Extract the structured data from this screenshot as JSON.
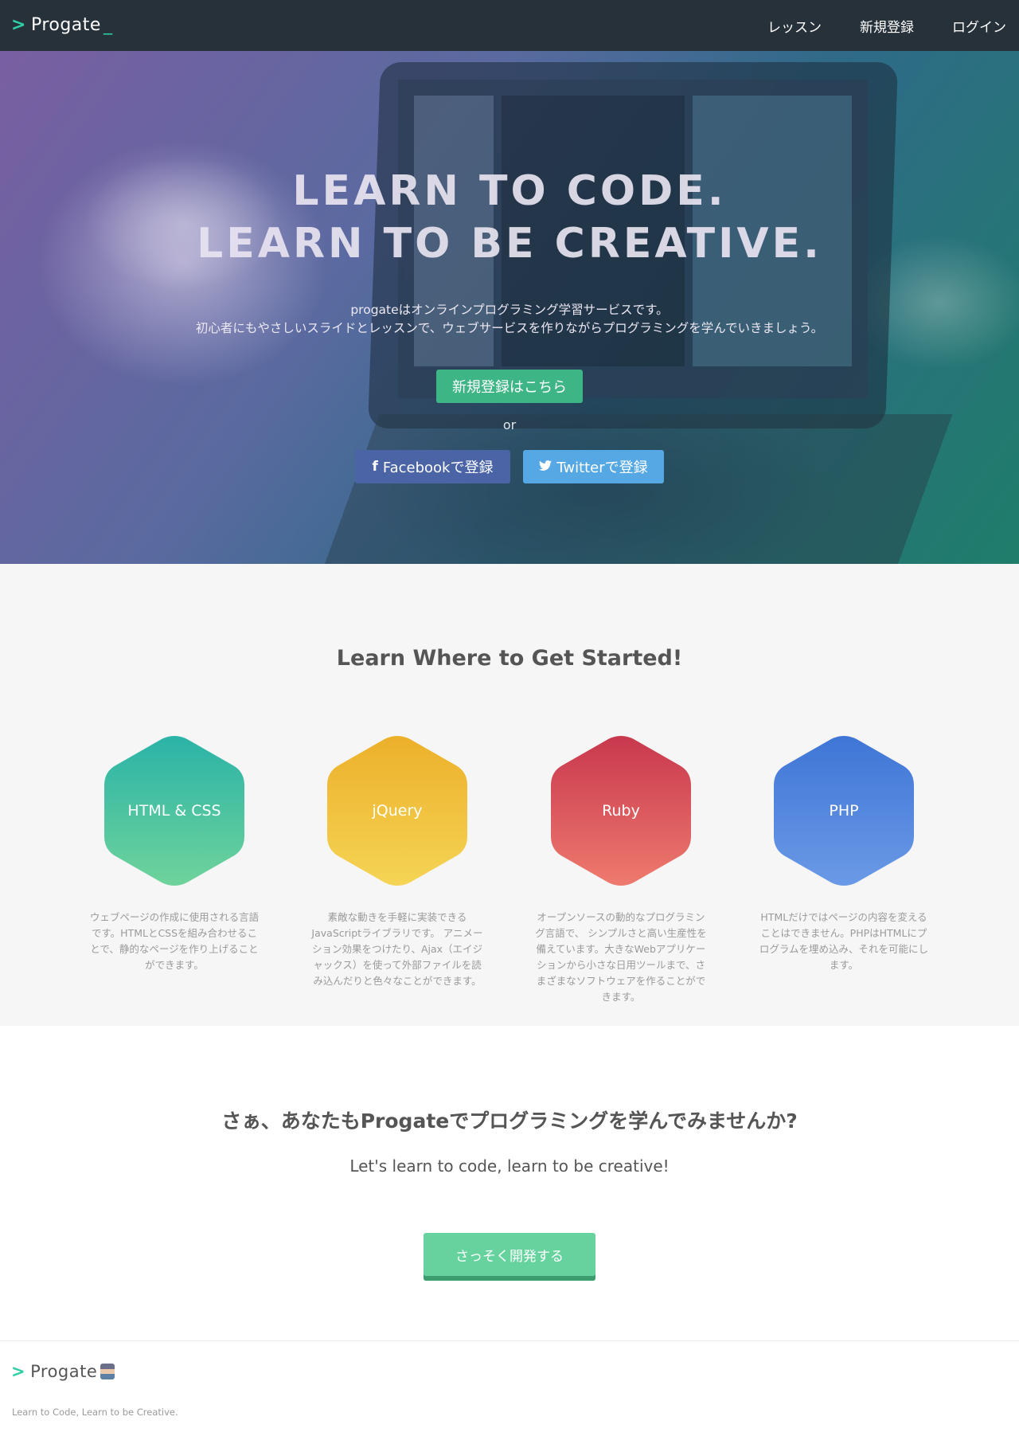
{
  "header": {
    "logo_text": "Progate",
    "nav": [
      "レッスン",
      "新規登録",
      "ログイン"
    ]
  },
  "hero": {
    "title_line1": "LEARN TO CODE.",
    "title_line2": "LEARN TO BE CREATIVE.",
    "subtitle_line1": "progateはオンラインプログラミング学習サービスです。",
    "subtitle_line2": "初心者にもやさしいスライドとレッスンで、ウェブサービスを作りながらプログラミングを学んでいきましょう。",
    "signup_button": "新規登録はこちら",
    "or_text": "or",
    "facebook_button": "Facebookで登録",
    "twitter_button": "Twitterで登録"
  },
  "courses": {
    "title": "Learn Where to Get Started!",
    "items": [
      {
        "label": "HTML & CSS",
        "color": "#3cbfa6",
        "desc": "ウェブページの作成に使用される言語です。HTMLとCSSを組み合わせることで、静的なページを作り上げることができます。"
      },
      {
        "label": "jQuery",
        "color": "#f0bf2e",
        "desc": "素敵な動きを手軽に実装できるJavaScriptライブラリです。 アニメーション効果をつけたり、Ajax（エイジャックス）を使って外部ファイルを読み込んだりと色々なことができます。"
      },
      {
        "label": "Ruby",
        "color": "#e15a60",
        "desc": "オープンソースの動的なプログラミング言語で、 シンプルさと高い生産性を備えています。大きなWebアプリケーションから小さな日用ツールまで、さまざまなソフトウェアを作ることができます。"
      },
      {
        "label": "PHP",
        "color": "#4f86df",
        "desc": "HTMLだけではページの内容を変えることはできません。PHPはHTMLにプログラムを埋め込み、それを可能にします。"
      }
    ]
  },
  "cta": {
    "title": "さぁ、あなたもProgateでプログラミングを学んでみませんか?",
    "subtitle": "Let's learn to code, learn to be creative!",
    "button": "さっそく開発する"
  },
  "footer": {
    "logo_text": "Progate",
    "tagline": "Learn to Code, Learn to be Creative."
  }
}
